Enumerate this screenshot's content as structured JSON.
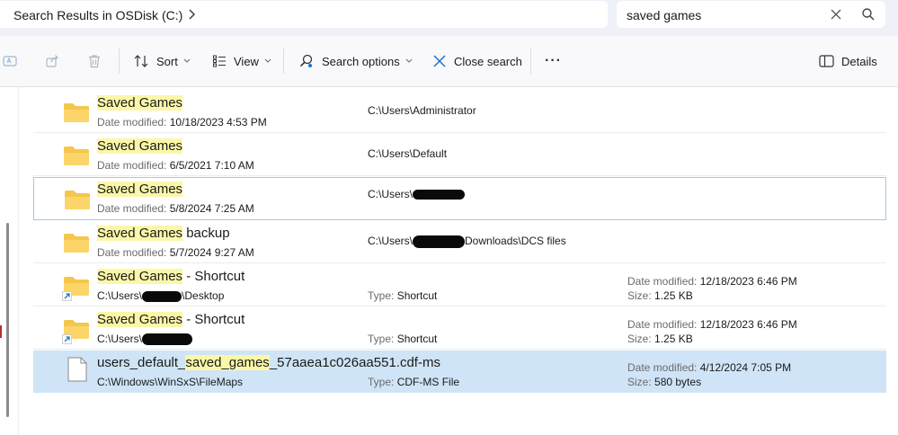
{
  "address": {
    "text": "Search Results in OSDisk (C:)"
  },
  "search": {
    "value": "saved games"
  },
  "toolbar": {
    "sort_label": "Sort",
    "view_label": "View",
    "search_options_label": "Search options",
    "close_search_label": "Close search",
    "more_label": "···",
    "details_label": "Details"
  },
  "labels": {
    "date_modified": "Date modified:",
    "type": "Type:",
    "size": "Size:"
  },
  "rows": [
    {
      "name_hl": "Saved Games",
      "name_rest": "",
      "date": "10/18/2023 4:53 PM",
      "path_a": "C:\\Users\\Administrator",
      "path_b": ""
    },
    {
      "name_hl": "Saved Games",
      "name_rest": "",
      "date": "6/5/2021 7:10 AM",
      "path_a": "C:\\Users\\Default",
      "path_b": ""
    },
    {
      "name_hl": "Saved Games",
      "name_rest": "",
      "date": "5/8/2024 7:25 AM",
      "path_a": "C:\\Users\\",
      "path_b": ""
    },
    {
      "name_hl": "Saved Games",
      "name_rest": " backup",
      "date": "5/7/2024 9:27 AM",
      "path_a": "C:\\Users\\",
      "path_b": "Downloads\\DCS files"
    },
    {
      "name_hl": "Saved Games",
      "name_rest": " - Shortcut",
      "loc_a": "C:\\Users\\",
      "loc_b": "\\Desktop",
      "type": "Shortcut",
      "date": "12/18/2023 6:46 PM",
      "size": "1.25 KB"
    },
    {
      "name_hl": "Saved Games",
      "name_rest": " - Shortcut",
      "loc_a": "C:\\Users\\",
      "loc_b": "",
      "type": "Shortcut",
      "date": "12/18/2023 6:46 PM",
      "size": "1.25 KB"
    },
    {
      "name_pre": "users_default_",
      "name_hl": "saved_games",
      "name_rest": "_57aaea1c026aa551.cdf-ms",
      "loc": "C:\\Windows\\WinSxS\\FileMaps",
      "type": "CDF-MS File",
      "date": "4/12/2024 7:05 PM",
      "size": "580 bytes"
    }
  ],
  "colors": {
    "highlight": "#fbf7a8",
    "selected_row": "#cfe4f6",
    "folder": "#f4c64c",
    "accent": "#1a73c8"
  }
}
